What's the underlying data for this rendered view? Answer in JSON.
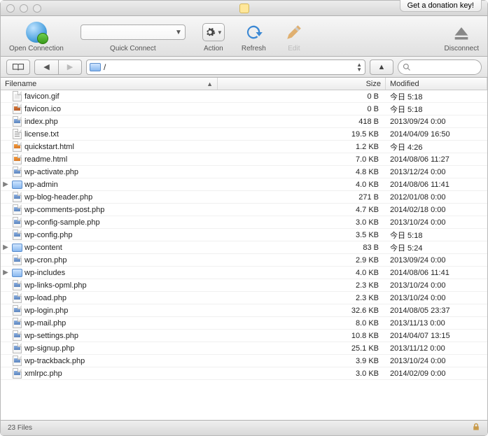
{
  "titlebar": {
    "donation_label": "Get a donation key!"
  },
  "toolbar": {
    "open_connection": "Open Connection",
    "quick_connect": "Quick Connect",
    "action": "Action",
    "refresh": "Refresh",
    "edit": "Edit",
    "disconnect": "Disconnect"
  },
  "pathbar": {
    "path": "/"
  },
  "columns": {
    "filename": "Filename",
    "size": "Size",
    "modified": "Modified"
  },
  "files": [
    {
      "name": "favicon.gif",
      "size": "0 B",
      "modified": "今日 5:18",
      "type": "gif",
      "expandable": false
    },
    {
      "name": "favicon.ico",
      "size": "0 B",
      "modified": "今日 5:18",
      "type": "ico",
      "expandable": false
    },
    {
      "name": "index.php",
      "size": "418 B",
      "modified": "2013/09/24 0:00",
      "type": "php",
      "expandable": false
    },
    {
      "name": "license.txt",
      "size": "19.5 KB",
      "modified": "2014/04/09 16:50",
      "type": "txt",
      "expandable": false
    },
    {
      "name": "quickstart.html",
      "size": "1.2 KB",
      "modified": "今日 4:26",
      "type": "html",
      "expandable": false
    },
    {
      "name": "readme.html",
      "size": "7.0 KB",
      "modified": "2014/08/06 11:27",
      "type": "html",
      "expandable": false
    },
    {
      "name": "wp-activate.php",
      "size": "4.8 KB",
      "modified": "2013/12/24 0:00",
      "type": "php",
      "expandable": false
    },
    {
      "name": "wp-admin",
      "size": "4.0 KB",
      "modified": "2014/08/06 11:41",
      "type": "folder",
      "expandable": true
    },
    {
      "name": "wp-blog-header.php",
      "size": "271 B",
      "modified": "2012/01/08 0:00",
      "type": "php",
      "expandable": false
    },
    {
      "name": "wp-comments-post.php",
      "size": "4.7 KB",
      "modified": "2014/02/18 0:00",
      "type": "php",
      "expandable": false
    },
    {
      "name": "wp-config-sample.php",
      "size": "3.0 KB",
      "modified": "2013/10/24 0:00",
      "type": "php",
      "expandable": false
    },
    {
      "name": "wp-config.php",
      "size": "3.5 KB",
      "modified": "今日 5:18",
      "type": "php",
      "expandable": false
    },
    {
      "name": "wp-content",
      "size": "83 B",
      "modified": "今日 5:24",
      "type": "folder",
      "expandable": true
    },
    {
      "name": "wp-cron.php",
      "size": "2.9 KB",
      "modified": "2013/09/24 0:00",
      "type": "php",
      "expandable": false
    },
    {
      "name": "wp-includes",
      "size": "4.0 KB",
      "modified": "2014/08/06 11:41",
      "type": "folder",
      "expandable": true
    },
    {
      "name": "wp-links-opml.php",
      "size": "2.3 KB",
      "modified": "2013/10/24 0:00",
      "type": "php",
      "expandable": false
    },
    {
      "name": "wp-load.php",
      "size": "2.3 KB",
      "modified": "2013/10/24 0:00",
      "type": "php",
      "expandable": false
    },
    {
      "name": "wp-login.php",
      "size": "32.6 KB",
      "modified": "2014/08/05 23:37",
      "type": "php",
      "expandable": false
    },
    {
      "name": "wp-mail.php",
      "size": "8.0 KB",
      "modified": "2013/11/13 0:00",
      "type": "php",
      "expandable": false
    },
    {
      "name": "wp-settings.php",
      "size": "10.8 KB",
      "modified": "2014/04/07 13:15",
      "type": "php",
      "expandable": false
    },
    {
      "name": "wp-signup.php",
      "size": "25.1 KB",
      "modified": "2013/11/12 0:00",
      "type": "php",
      "expandable": false
    },
    {
      "name": "wp-trackback.php",
      "size": "3.9 KB",
      "modified": "2013/10/24 0:00",
      "type": "php",
      "expandable": false
    },
    {
      "name": "xmlrpc.php",
      "size": "3.0 KB",
      "modified": "2014/02/09 0:00",
      "type": "php",
      "expandable": false
    }
  ],
  "status": {
    "count": "23 Files"
  }
}
